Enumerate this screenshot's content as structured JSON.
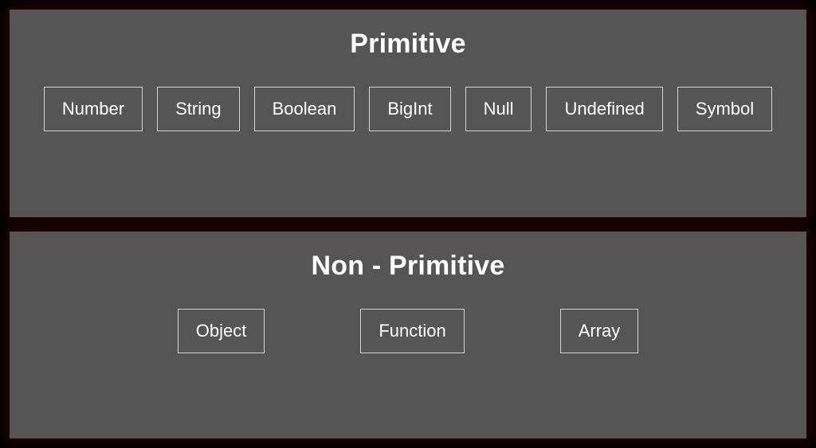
{
  "panels": {
    "primitive": {
      "title": "Primitive",
      "items": [
        "Number",
        "String",
        "Boolean",
        "BigInt",
        "Null",
        "Undefined",
        "Symbol"
      ]
    },
    "nonPrimitive": {
      "title": "Non - Primitive",
      "items": [
        "Object",
        "Function",
        "Array"
      ]
    }
  }
}
